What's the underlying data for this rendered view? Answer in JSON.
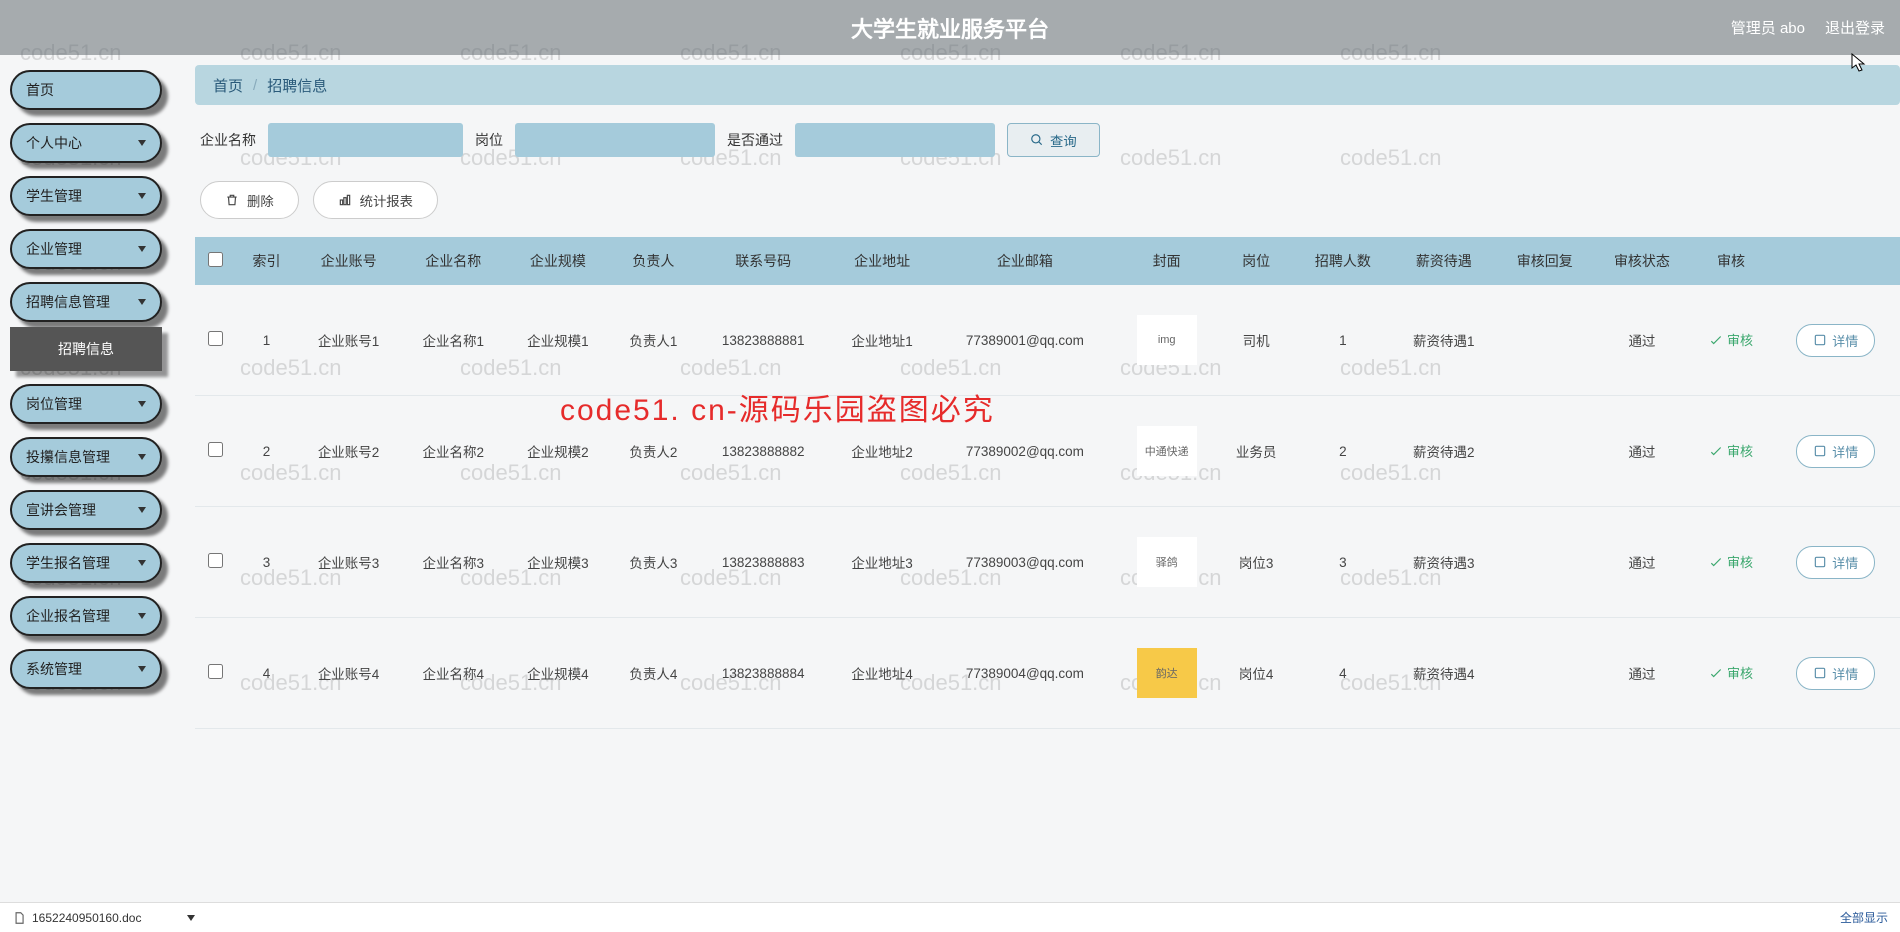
{
  "header": {
    "title": "大学生就业服务平台",
    "admin_label": "管理员 abo",
    "logout_label": "退出登录"
  },
  "sidebar": {
    "items": [
      {
        "label": "首页",
        "expandable": false
      },
      {
        "label": "个人中心",
        "expandable": true
      },
      {
        "label": "学生管理",
        "expandable": true
      },
      {
        "label": "企业管理",
        "expandable": true
      },
      {
        "label": "招聘信息管理",
        "expandable": true,
        "open": true,
        "sub": "招聘信息"
      },
      {
        "label": "岗位管理",
        "expandable": true
      },
      {
        "label": "投攥信息管理",
        "expandable": true
      },
      {
        "label": "宣讲会管理",
        "expandable": true
      },
      {
        "label": "学生报名管理",
        "expandable": true
      },
      {
        "label": "企业报名管理",
        "expandable": true
      },
      {
        "label": "系统管理",
        "expandable": true
      }
    ]
  },
  "breadcrumb": {
    "home": "首页",
    "current": "招聘信息"
  },
  "search": {
    "label_name": "企业名称",
    "label_post": "岗位",
    "label_pass": "是否通过",
    "btn_query": "查询"
  },
  "actions": {
    "delete": "删除",
    "report": "统计报表"
  },
  "table": {
    "headers": [
      "",
      "索引",
      "企业账号",
      "企业名称",
      "企业规模",
      "负责人",
      "联系号码",
      "企业地址",
      "企业邮箱",
      "封面",
      "岗位",
      "招聘人数",
      "薪资待遇",
      "审核回复",
      "审核状态",
      "审核",
      ""
    ],
    "audit_btn": "审核",
    "detail_btn": "详情",
    "rows": [
      {
        "idx": "1",
        "acct": "企业账号1",
        "name": "企业名称1",
        "scale": "企业规模1",
        "person": "负责人1",
        "phone": "13823888881",
        "addr": "企业地址1",
        "email": "77389001@qq.com",
        "cover": "img",
        "post": "司机",
        "count": "1",
        "salary": "薪资待遇1",
        "reply": "",
        "status": "通过"
      },
      {
        "idx": "2",
        "acct": "企业账号2",
        "name": "企业名称2",
        "scale": "企业规模2",
        "person": "负责人2",
        "phone": "13823888882",
        "addr": "企业地址2",
        "email": "77389002@qq.com",
        "cover": "中通快递",
        "post": "业务员",
        "count": "2",
        "salary": "薪资待遇2",
        "reply": "",
        "status": "通过"
      },
      {
        "idx": "3",
        "acct": "企业账号3",
        "name": "企业名称3",
        "scale": "企业规模3",
        "person": "负责人3",
        "phone": "13823888883",
        "addr": "企业地址3",
        "email": "77389003@qq.com",
        "cover": "驿鸽",
        "post": "岗位3",
        "count": "3",
        "salary": "薪资待遇3",
        "reply": "",
        "status": "通过"
      },
      {
        "idx": "4",
        "acct": "企业账号4",
        "name": "企业名称4",
        "scale": "企业规模4",
        "person": "负责人4",
        "phone": "13823888884",
        "addr": "企业地址4",
        "email": "77389004@qq.com",
        "cover": "韵达",
        "post": "岗位4",
        "count": "4",
        "salary": "薪资待遇4",
        "reply": "",
        "status": "通过"
      }
    ]
  },
  "overlay_text": "code51. cn-源码乐园盗图必究",
  "download": {
    "file": "1652240950160.doc",
    "show_all": "全部显示"
  },
  "watermark": "code51.cn"
}
